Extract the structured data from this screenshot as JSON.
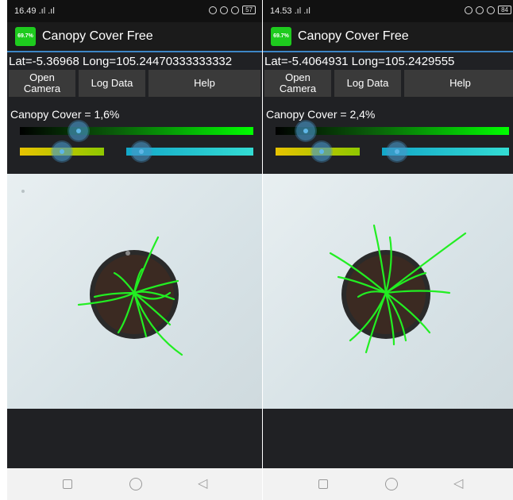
{
  "left": {
    "status": {
      "time": "16.49",
      "signal": ".ıl .ıl",
      "battery": "57"
    },
    "app": {
      "logo_text": "69.7%",
      "title": "Canopy Cover Free"
    },
    "coords": {
      "text": "Lat=-5.36968  Long=105.24470333333332"
    },
    "buttons": {
      "open_camera": "Open\nCamera",
      "log_data": "Log Data",
      "help": "Help"
    },
    "cover_text": "Canopy Cover = 1,6%",
    "sliders": {
      "green": 0.25,
      "yellow": 0.5,
      "cyan": 0.12
    }
  },
  "right": {
    "status": {
      "time": "14.53",
      "signal": ".ıl .ıl",
      "battery": "84"
    },
    "app": {
      "logo_text": "69.7%",
      "title": "Canopy Cover Free"
    },
    "coords": {
      "text": "Lat=-5.4064931  Long=105.2429555"
    },
    "buttons": {
      "open_camera": "Open\nCamera",
      "log_data": "Log Data",
      "help": "Help"
    },
    "cover_text": "Canopy Cover = 2,4%",
    "sliders": {
      "green": 0.13,
      "yellow": 0.55,
      "cyan": 0.12
    }
  },
  "colors": {
    "accent_line": "#3d86c6",
    "leaf_green": "#22ee22",
    "pot_soil": "#3b2a22"
  }
}
